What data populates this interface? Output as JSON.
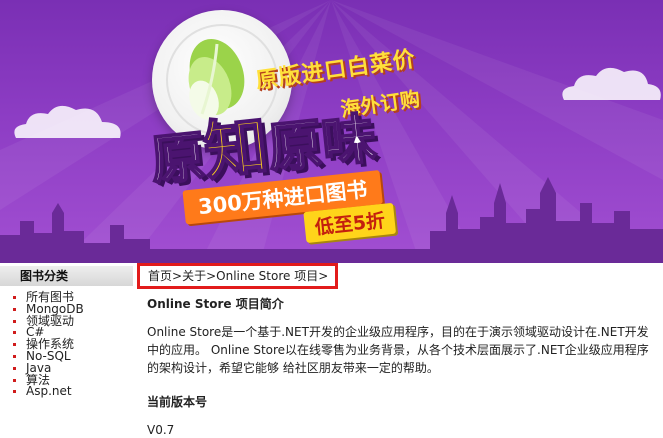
{
  "banner": {
    "headline_1": "原版进口白菜价",
    "headline_2": "海外订购",
    "big_title": [
      "原",
      "知",
      "原",
      "味"
    ],
    "promo_1": "300万种进口图书",
    "promo_2": "低至5折",
    "colors": {
      "background": "#8d3dc4",
      "yellow": "#ffd31a",
      "orange": "#ff7a1a"
    }
  },
  "sidebar": {
    "title": "图书分类",
    "items": [
      "所有图书",
      "MongoDB",
      "领域驱动",
      "C#",
      "操作系统",
      "No-SQL",
      "Java",
      "算法",
      "Asp.net"
    ]
  },
  "breadcrumb": {
    "home": "首页",
    "sep": ">",
    "about": "关于",
    "current": "Online Store 项目"
  },
  "content": {
    "section_title": "Online Store 项目简介",
    "intro": "Online Store是一个基于.NET开发的企业级应用程序，目的在于演示领域驱动设计在.NET开发中的应用。 Online Store以在线零售为业务背景，从各个技术层面展示了.NET企业级应用程序的架构设计，希望它能够 给社区朋友带来一定的帮助。",
    "version_title": "当前版本号",
    "version_value": "V0.7"
  }
}
